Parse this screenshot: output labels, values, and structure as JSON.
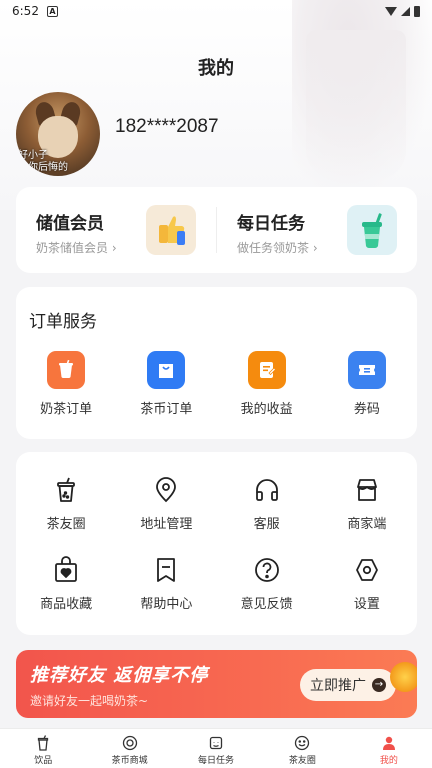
{
  "status_bar": {
    "time": "6:52",
    "notification_icon": "a-icon"
  },
  "page_title": "我的",
  "profile": {
    "phone": "182****2087",
    "avatar_caption_line1": "好小子",
    "avatar_caption_line2": "有你后悔的"
  },
  "membership": [
    {
      "title": "储值会员",
      "subtitle": "奶茶储值会员 ›",
      "icon": "thumbs-up-icon"
    },
    {
      "title": "每日任务",
      "subtitle": "做任务领奶茶 ›",
      "icon": "drink-cup-icon"
    }
  ],
  "orders": {
    "title": "订单服务",
    "items": [
      {
        "label": "奶茶订单",
        "icon": "tea-order-icon",
        "color": "#f7753d"
      },
      {
        "label": "茶币订单",
        "icon": "shopping-bag-icon",
        "color": "#2f7bf4"
      },
      {
        "label": "我的收益",
        "icon": "earnings-icon",
        "color": "#f58b0e"
      },
      {
        "label": "券码",
        "icon": "ticket-icon",
        "color": "#3b82f0"
      }
    ]
  },
  "tools": {
    "row1": [
      {
        "label": "茶友圈",
        "icon": "bubble-tea-icon"
      },
      {
        "label": "地址管理",
        "icon": "location-pin-icon"
      },
      {
        "label": "客服",
        "icon": "headphones-icon"
      },
      {
        "label": "商家端",
        "icon": "store-icon"
      }
    ],
    "row2": [
      {
        "label": "商品收藏",
        "icon": "heart-bag-icon"
      },
      {
        "label": "帮助中心",
        "icon": "bookmark-icon"
      },
      {
        "label": "意见反馈",
        "icon": "question-icon"
      },
      {
        "label": "设置",
        "icon": "hexagon-settings-icon"
      }
    ]
  },
  "banner": {
    "title": "推荐好友  返佣享不停",
    "subtitle": "邀请好友一起喝奶茶~",
    "button": "立即推广"
  },
  "bottom_nav": [
    {
      "label": "饮品",
      "icon": "cup-icon",
      "active": false
    },
    {
      "label": "茶币商城",
      "icon": "coin-icon",
      "active": false
    },
    {
      "label": "每日任务",
      "icon": "task-icon",
      "active": false
    },
    {
      "label": "茶友圈",
      "icon": "smile-icon",
      "active": false
    },
    {
      "label": "我的",
      "icon": "person-icon",
      "active": true
    }
  ],
  "colors": {
    "accent": "#f0504a",
    "banner": "#f2554c"
  }
}
